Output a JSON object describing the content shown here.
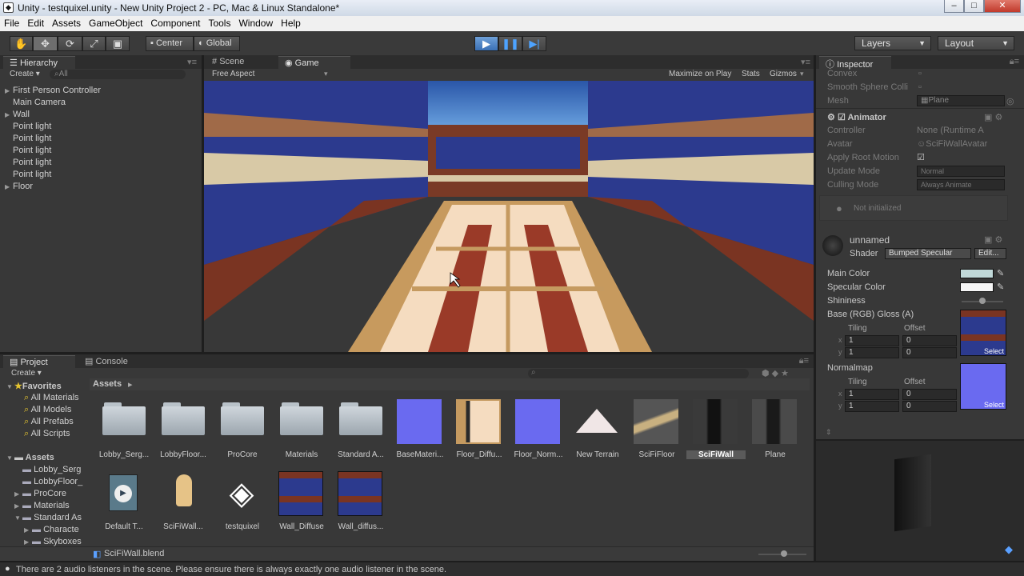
{
  "window": {
    "title": "Unity - testquixel.unity - New Unity Project 2 - PC, Mac & Linux Standalone*",
    "min": "–",
    "max": "□",
    "close": "✕"
  },
  "menu": [
    "File",
    "Edit",
    "Assets",
    "GameObject",
    "Component",
    "Tools",
    "Window",
    "Help"
  ],
  "toolbar": {
    "center_label": "Center",
    "global_label": "Global",
    "layers_label": "Layers",
    "layout_label": "Layout"
  },
  "hierarchy": {
    "tab": "Hierarchy",
    "create": "Create",
    "search_placeholder": "All",
    "items": [
      {
        "label": "First Person Controller",
        "expandable": true
      },
      {
        "label": "Main Camera",
        "expandable": false
      },
      {
        "label": "Wall",
        "expandable": true
      },
      {
        "label": "Point light",
        "expandable": false
      },
      {
        "label": "Point light",
        "expandable": false
      },
      {
        "label": "Point light",
        "expandable": false
      },
      {
        "label": "Point light",
        "expandable": false
      },
      {
        "label": "Point light",
        "expandable": false
      },
      {
        "label": "Floor",
        "expandable": true
      }
    ]
  },
  "view": {
    "tab_scene": "Scene",
    "tab_game": "Game",
    "aspect": "Free Aspect",
    "maximize": "Maximize on Play",
    "stats": "Stats",
    "gizmos": "Gizmos"
  },
  "inspector": {
    "tab": "Inspector",
    "convex": "Convex",
    "smooth": "Smooth Sphere Colli",
    "mesh_label": "Mesh",
    "mesh_value": "Plane",
    "animator_title": "Animator",
    "controller_label": "Controller",
    "controller_value": "None (Runtime A",
    "avatar_label": "Avatar",
    "avatar_value": "SciFiWallAvatar",
    "root_motion_label": "Apply Root Motion",
    "update_mode_label": "Update Mode",
    "update_mode_value": "Normal",
    "culling_label": "Culling Mode",
    "culling_value": "Always Animate",
    "not_init": "Not initialized",
    "material_name": "unnamed",
    "shader_label": "Shader",
    "shader_value": "Bumped Specular",
    "edit_label": "Edit...",
    "main_color": "Main Color",
    "spec_color": "Specular Color",
    "shininess": "Shininess",
    "base_tex": "Base (RGB) Gloss (A)",
    "tiling": "Tiling",
    "offset": "Offset",
    "x": "x",
    "y": "y",
    "tiling_x": "1",
    "tiling_y": "1",
    "offset_x": "0",
    "offset_y": "0",
    "normalmap": "Normalmap",
    "tiling_x2": "1",
    "tiling_y2": "1",
    "offset_x2": "0",
    "offset_y2": "0",
    "select": "Select",
    "select2": "Select"
  },
  "project": {
    "tab_project": "Project",
    "tab_console": "Console",
    "create": "Create",
    "favorites": "Favorites",
    "fav_items": [
      "All Materials",
      "All Models",
      "All Prefabs",
      "All Scripts"
    ],
    "assets_root": "Assets",
    "tree": [
      {
        "label": "Lobby_Serg",
        "depth": 1
      },
      {
        "label": "LobbyFloor_",
        "depth": 1
      },
      {
        "label": "ProCore",
        "depth": 1,
        "expandable": true
      },
      {
        "label": "Materials",
        "depth": 1,
        "expandable": true
      },
      {
        "label": "Standard As",
        "depth": 1,
        "expandable": true,
        "open": true
      },
      {
        "label": "Characte",
        "depth": 2,
        "expandable": true
      },
      {
        "label": "Skyboxes",
        "depth": 2,
        "expandable": true
      }
    ],
    "breadcrumb": "Assets",
    "row1": [
      "Lobby_Serg...",
      "LobbyFloor...",
      "ProCore",
      "Materials",
      "Standard A...",
      "BaseMateri...",
      "Floor_Diffu...",
      "Floor_Norm...",
      "New Terrain",
      "SciFiFloor",
      "SciFiWall",
      "Plane"
    ],
    "row2": [
      "Default T...",
      "SciFiWall...",
      "testquixel",
      "Wall_Diffuse",
      "Wall_diffus..."
    ],
    "selected_file": "SciFiWall.blend"
  },
  "status": "There are 2 audio listeners in the scene. Please ensure there is always exactly one audio listener in the scene."
}
